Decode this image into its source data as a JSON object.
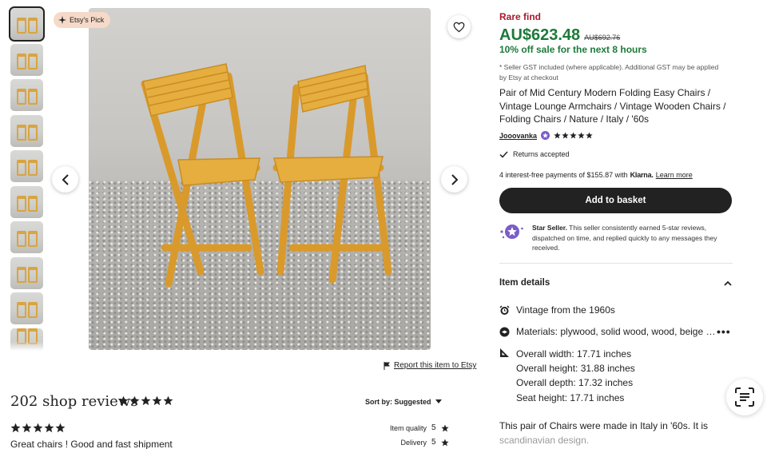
{
  "gallery": {
    "badge": "Etsy's Pick",
    "thumbnail_count": 10
  },
  "report_link": "Report this item to Etsy",
  "reviews": {
    "title": "202 shop reviews",
    "overall_stars": 5,
    "sort_label": "Sort by: Suggested",
    "first_review": {
      "stars": 5,
      "text": "Great chairs ! Good and fast shipment",
      "ratings": [
        {
          "label": "Item quality",
          "value": "5"
        },
        {
          "label": "Delivery",
          "value": "5"
        }
      ]
    }
  },
  "listing": {
    "rare_label": "Rare find",
    "price": "AU$623.48",
    "original_price": "AU$692.76",
    "sale_text": "10% off sale for the next 8 hours",
    "gst_note": "* Seller GST included (where applicable). Additional GST may be applied by Etsy at checkout",
    "title": "Pair of Mid Century Modern Folding Easy Chairs / Vintage Lounge Armchairs / Vintage Wooden Chairs / Folding Chairs / Nature / Italy / '60s",
    "shop_name": "Jooovanka",
    "shop_stars": 5,
    "returns": "Returns accepted",
    "installments_prefix": "4 interest-free payments of $155.87 with",
    "klarna": "Klarna.",
    "learn_more": "Learn more",
    "basket_button": "Add to basket",
    "star_seller_title": "Star Seller.",
    "star_seller_text": "This seller consistently earned 5-star reviews, dispatched on time, and replied quickly to any messages they received.",
    "item_details_label": "Item details",
    "vintage": "Vintage from the 1960s",
    "materials": "Materials: plywood, solid wood, wood, beige …",
    "dimensions": [
      "Overall width: 17.71 inches",
      "Overall height: 31.88 inches",
      "Overall depth: 17.32 inches",
      "Seat height: 17.71 inches"
    ],
    "description_visible": "This pair of Chairs were made in Italy in '60s. It is",
    "description_faded": "scandinavian design."
  },
  "colors": {
    "rare": "#a61a2e",
    "price": "#1d7a3a",
    "button": "#222222",
    "badge_bg": "#f6d9c8"
  }
}
